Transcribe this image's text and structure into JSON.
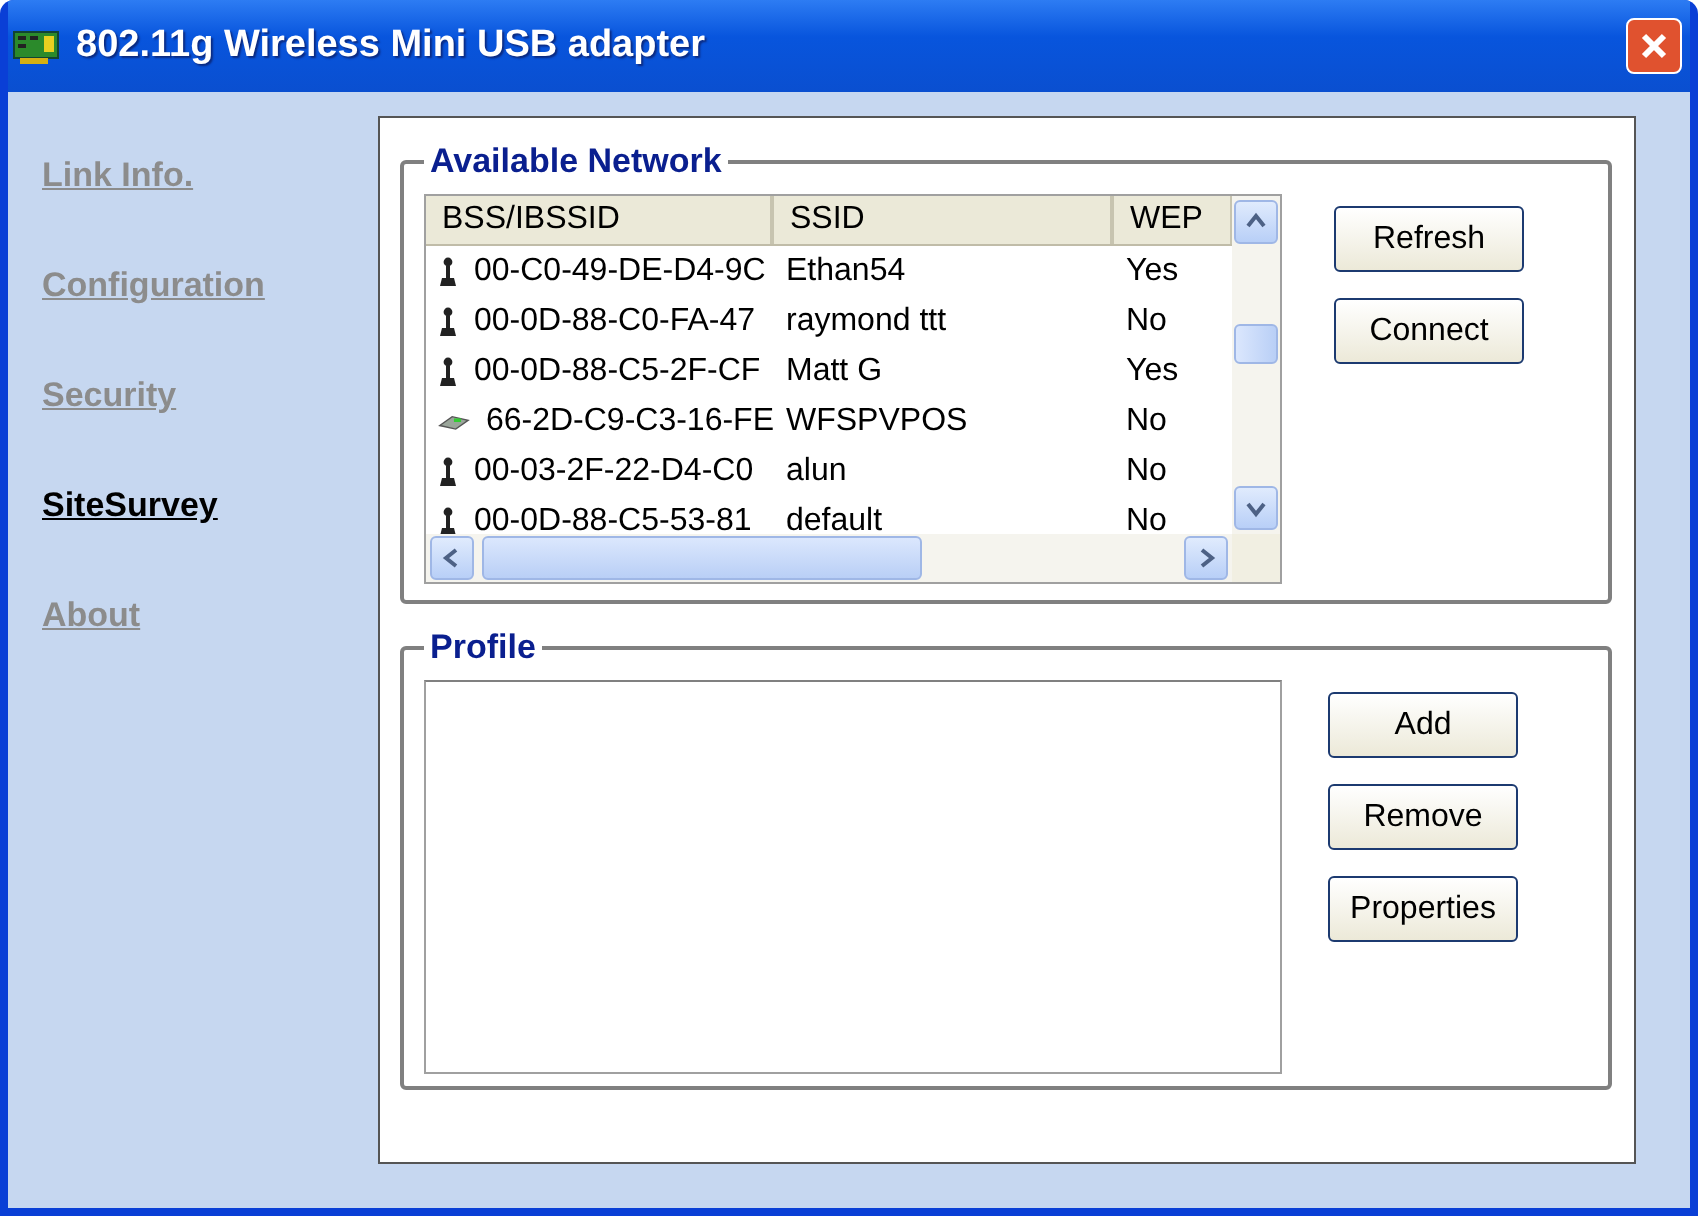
{
  "window": {
    "title": "802.11g Wireless Mini USB adapter"
  },
  "sidebar": {
    "items": [
      {
        "label": "Link Info.",
        "selected": false
      },
      {
        "label": "Configuration",
        "selected": false
      },
      {
        "label": "Security",
        "selected": false
      },
      {
        "label": "SiteSurvey",
        "selected": true
      },
      {
        "label": "About",
        "selected": false
      }
    ]
  },
  "available_network": {
    "title": "Available Network",
    "columns": [
      "BSS/IBSSID",
      "SSID",
      "WEP"
    ],
    "rows": [
      {
        "kind": "station",
        "bssid": "00-C0-49-DE-D4-9C",
        "ssid": "Ethan54",
        "wep": "Yes"
      },
      {
        "kind": "station",
        "bssid": "00-0D-88-C0-FA-47",
        "ssid": "raymond ttt",
        "wep": "No"
      },
      {
        "kind": "station",
        "bssid": "00-0D-88-C5-2F-CF",
        "ssid": "Matt G",
        "wep": "Yes"
      },
      {
        "kind": "access-point",
        "bssid": "66-2D-C9-C3-16-FE",
        "ssid": "WFSPVPOS",
        "wep": "No"
      },
      {
        "kind": "station",
        "bssid": "00-03-2F-22-D4-C0",
        "ssid": "alun",
        "wep": "No"
      },
      {
        "kind": "station",
        "bssid": "00-0D-88-C5-53-81",
        "ssid": "default",
        "wep": "No"
      }
    ],
    "buttons": [
      "Refresh",
      "Connect"
    ]
  },
  "profile": {
    "title": "Profile",
    "buttons": [
      "Add",
      "Remove",
      "Properties"
    ]
  }
}
